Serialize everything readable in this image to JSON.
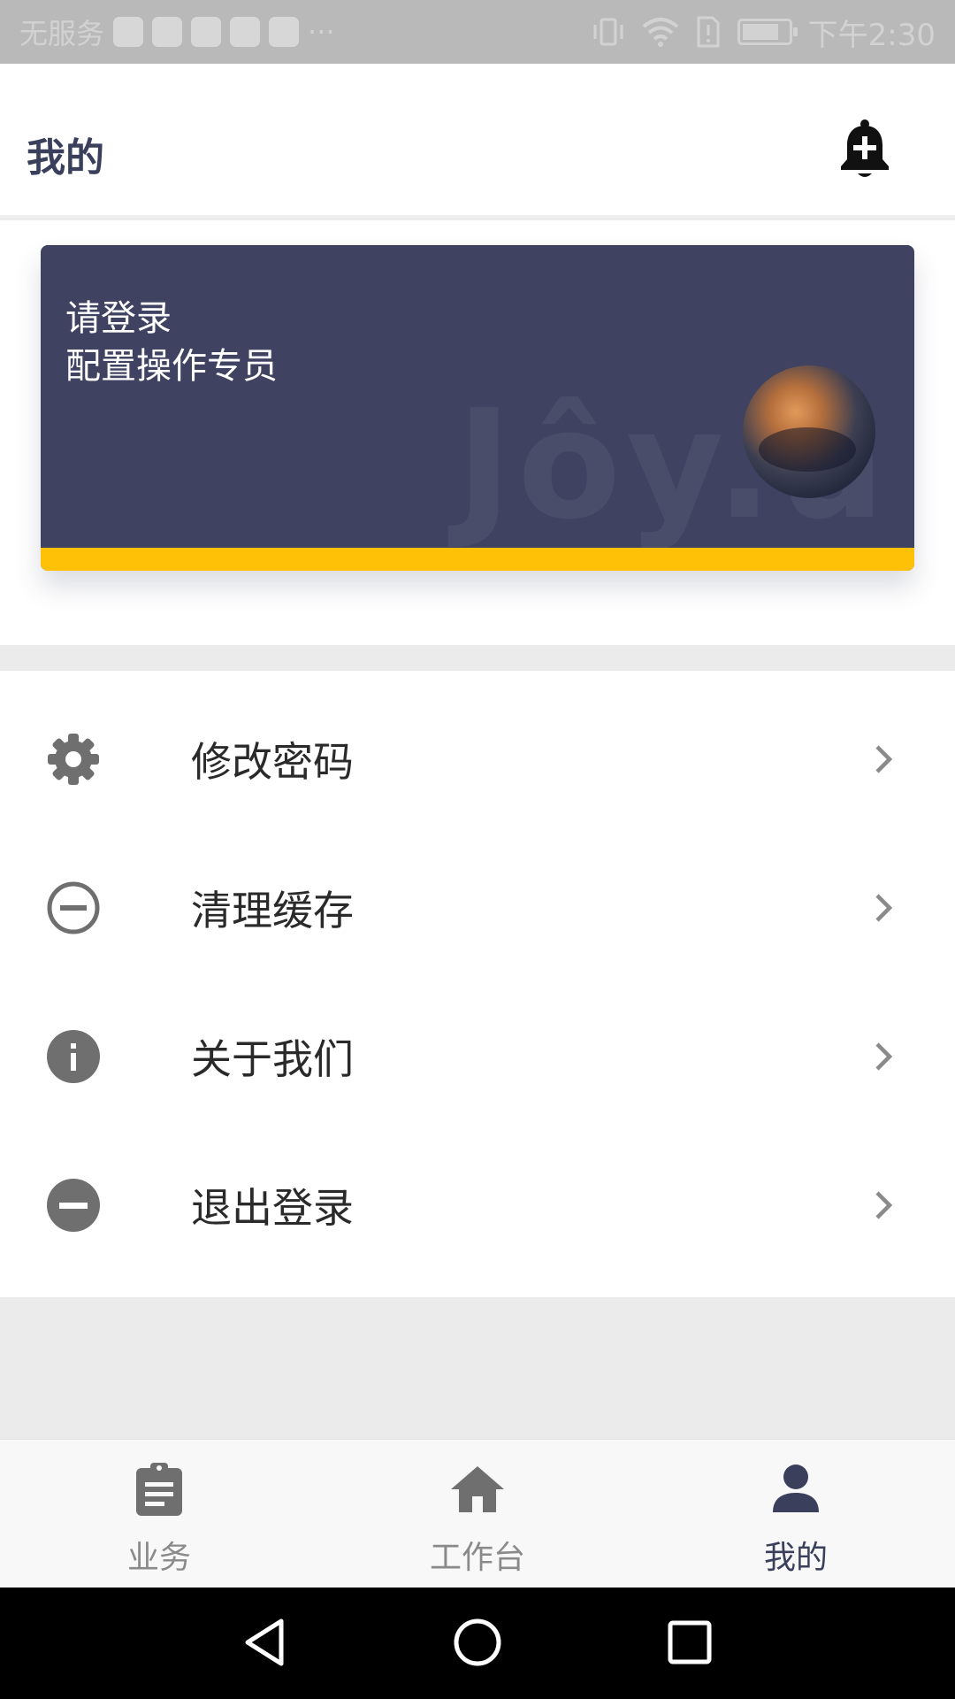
{
  "status_bar": {
    "carrier": "无服务",
    "more": "···",
    "time": "下午2:30",
    "app_colors": [
      "#e2463e",
      "#e7b4c9",
      "#e45a5a",
      "#5aa5d8",
      "#4fc1d4"
    ]
  },
  "header": {
    "title": "我的",
    "bell_icon": "bell-plus-icon"
  },
  "profile": {
    "line1": "请登录",
    "line2": "配置操作专员",
    "watermark": "Jôy.u",
    "card_color": "#3f4261",
    "stripe_color": "#ffc107"
  },
  "menu": {
    "items": [
      {
        "label": "修改密码",
        "icon": "gear-icon"
      },
      {
        "label": "清理缓存",
        "icon": "minus-circle-outline-icon"
      },
      {
        "label": "关于我们",
        "icon": "info-icon"
      },
      {
        "label": "退出登录",
        "icon": "minus-circle-icon"
      }
    ]
  },
  "bottom_nav": {
    "items": [
      {
        "label": "业务",
        "icon": "clipboard-icon"
      },
      {
        "label": "工作台",
        "icon": "home-icon"
      },
      {
        "label": "我的",
        "icon": "person-icon",
        "active": true
      }
    ],
    "active_color": "#3a3f5c",
    "inactive_color": "#6f6f6f"
  },
  "system_nav": {
    "buttons": [
      "back-icon",
      "home-circle-icon",
      "recents-icon"
    ]
  }
}
